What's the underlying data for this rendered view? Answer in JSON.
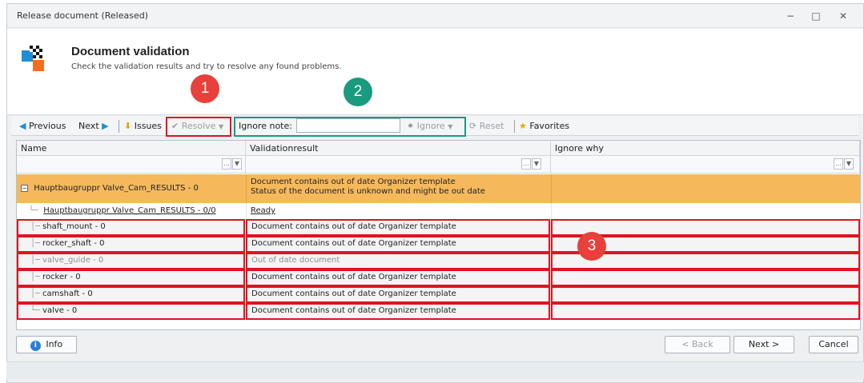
{
  "window": {
    "title": "Release document (Released)",
    "minimize": "−",
    "maximize": "□",
    "close": "✕"
  },
  "header": {
    "title": "Document validation",
    "subtitle": "Check the validation results and try to resolve any found problems."
  },
  "toolbar": {
    "previous": "Previous",
    "next": "Next",
    "issues": "Issues",
    "resolve": "Resolve",
    "ignore_note_label": "Ignore note:",
    "ignore_note_value": "",
    "ignore": "Ignore",
    "reset": "Reset",
    "favorites": "Favorites"
  },
  "grid": {
    "columns": [
      "Name",
      "Validationresult",
      "Ignore why"
    ],
    "filter_button": "...",
    "rows": [
      {
        "name": "Hauptbaugruppr Valve_Cam_RESULTS - 0",
        "result_line1": "Document contains out of date Organizer template",
        "result_line2": "Status of the document is unknown and might be out date",
        "ignore_why": ""
      },
      {
        "name": "Hauptbaugruppr Valve_Cam_RESULTS - 0/0",
        "result": "Ready",
        "ignore_why": ""
      },
      {
        "name": "shaft_mount - 0",
        "result": "Document contains out of date Organizer template",
        "ignore_why": ""
      },
      {
        "name": "rocker_shaft - 0",
        "result": "Document contains out of date Organizer template",
        "ignore_why": ""
      },
      {
        "name": "valve_guide - 0",
        "result": "Out of date document",
        "ignore_why": ""
      },
      {
        "name": "rocker - 0",
        "result": "Document contains out of date Organizer template",
        "ignore_why": ""
      },
      {
        "name": "camshaft - 0",
        "result": "Document contains out of date Organizer template",
        "ignore_why": ""
      },
      {
        "name": "valve - 0",
        "result": "Document contains out of date Organizer template",
        "ignore_why": ""
      }
    ]
  },
  "annotations": {
    "badge1": "1",
    "badge2": "2",
    "badge3": "3",
    "red": "#e0141e",
    "badge_red": "#e8403a",
    "teal": "#1a9a7e",
    "row_highlight": "#f5b95c"
  },
  "footer": {
    "info": "Info",
    "back": "< Back",
    "next": "Next >",
    "cancel": "Cancel"
  }
}
